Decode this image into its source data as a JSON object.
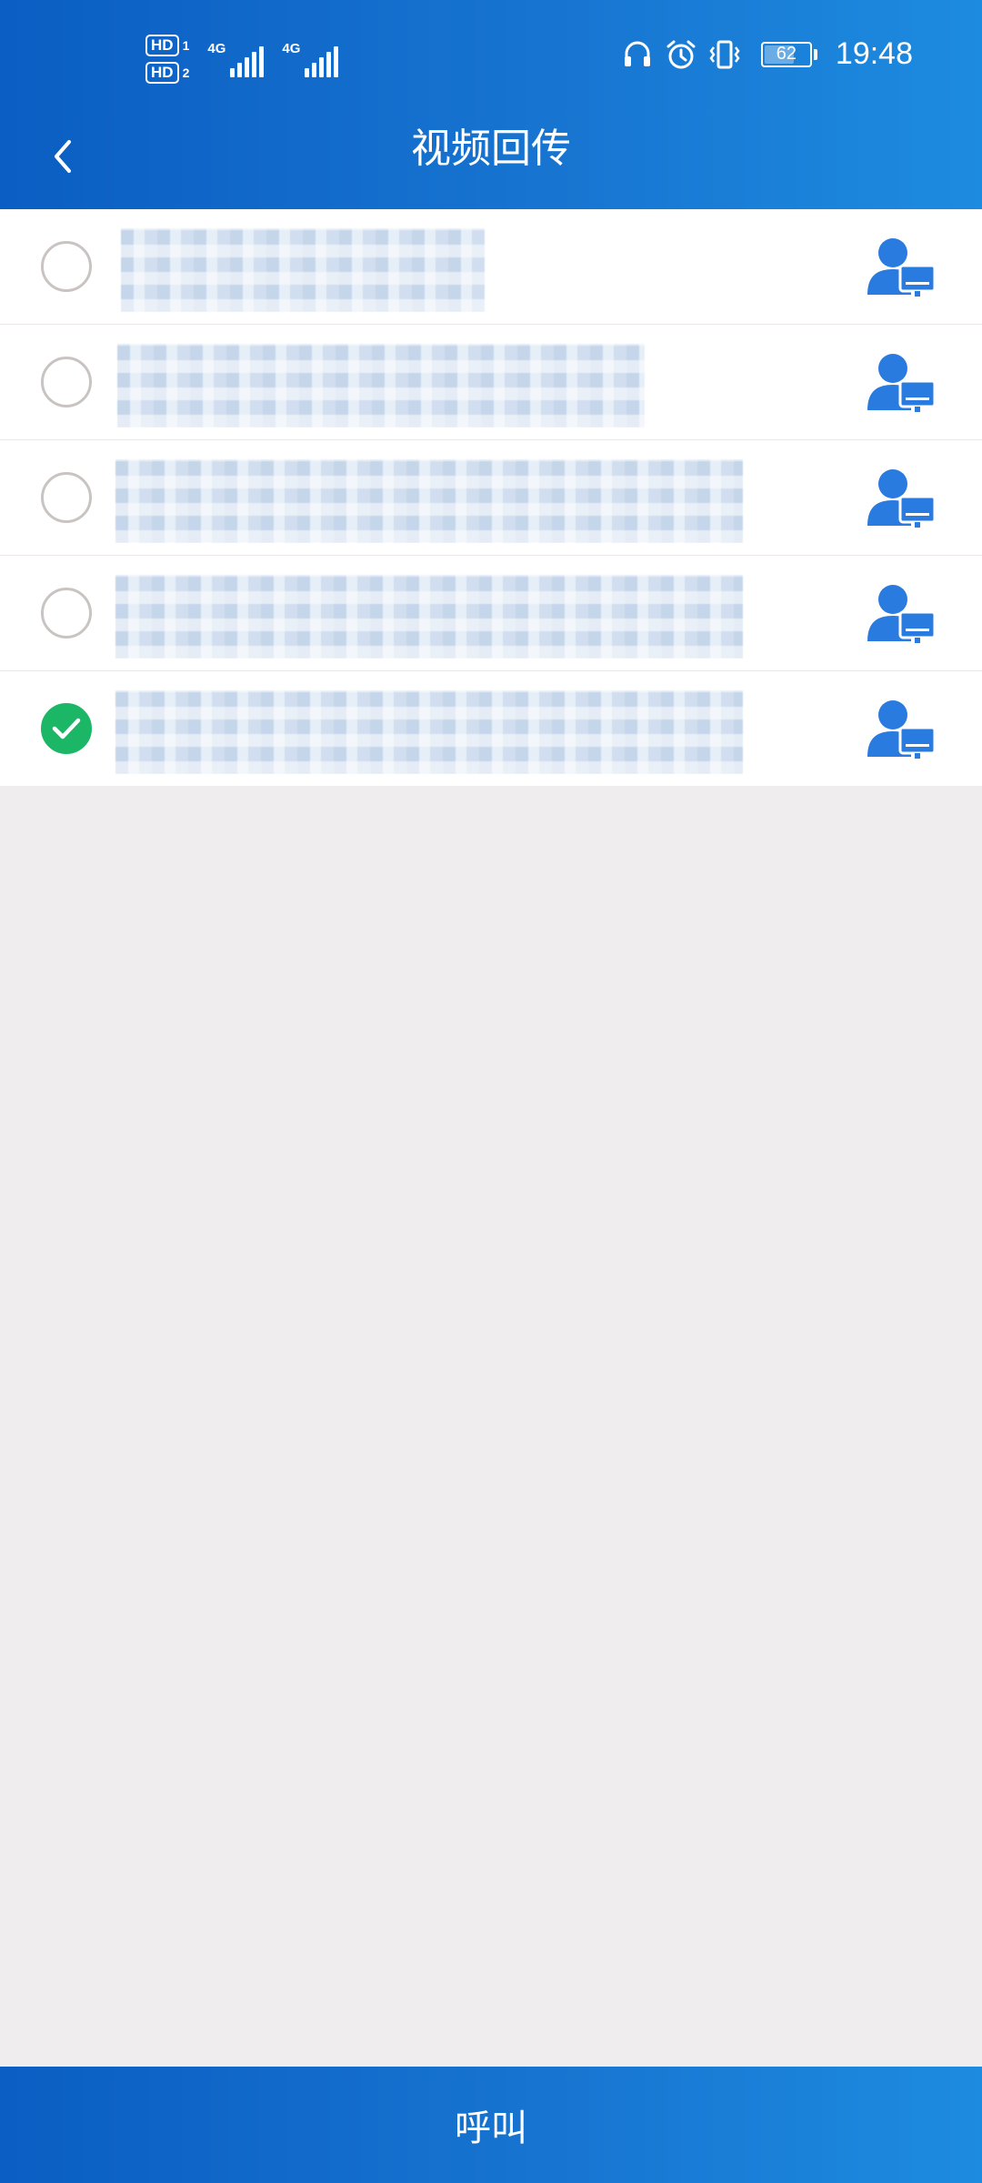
{
  "status_bar": {
    "sim1_label": "HD",
    "sim1_num": "1",
    "sim2_label": "HD",
    "sim2_num": "2",
    "network1": "4G",
    "network2": "4G",
    "battery_level": "62",
    "time": "19:48",
    "icons": [
      "headset-icon",
      "alarm-icon",
      "vibrate-icon",
      "battery-icon"
    ]
  },
  "header": {
    "title": "视频回传",
    "back_icon": "chevron-left-icon"
  },
  "contacts": {
    "items": [
      {
        "selected": false,
        "name": "",
        "type_icon": "person-monitor-icon"
      },
      {
        "selected": false,
        "name": "",
        "type_icon": "person-monitor-icon"
      },
      {
        "selected": false,
        "name": "",
        "type_icon": "person-monitor-icon"
      },
      {
        "selected": false,
        "name": "",
        "type_icon": "person-monitor-icon"
      },
      {
        "selected": true,
        "name": "",
        "type_icon": "person-monitor-icon"
      }
    ]
  },
  "footer": {
    "call_label": "呼叫"
  },
  "colors": {
    "header_start": "#0b5ec3",
    "header_end": "#1d8be0",
    "selected_green": "#1cb766",
    "icon_blue": "#2a7be0",
    "background": "#efeded"
  }
}
